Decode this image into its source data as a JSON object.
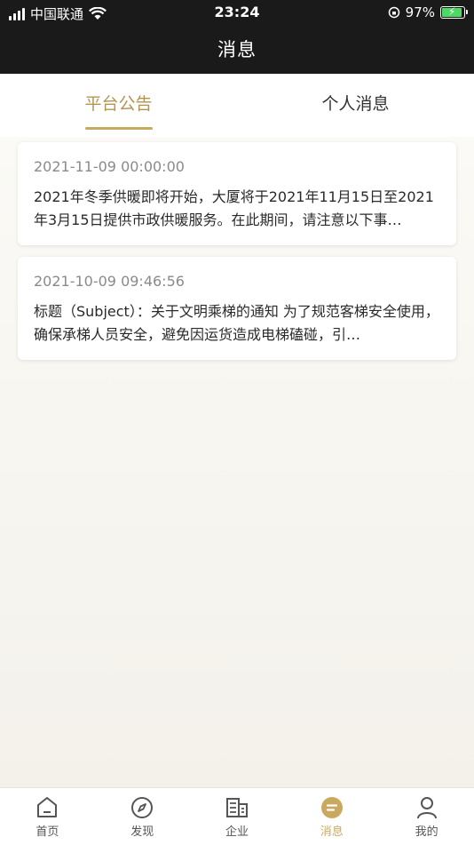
{
  "status_bar": {
    "carrier": "中国联通",
    "time": "23:24",
    "battery": "97%",
    "battery_level": 0.97
  },
  "header": {
    "title": "消息"
  },
  "tabs": [
    {
      "label": "平台公告",
      "active": true
    },
    {
      "label": "个人消息",
      "active": false
    }
  ],
  "messages": [
    {
      "date": "2021-11-09 00:00:00",
      "text": "2021年冬季供暖即将开始，大厦将于2021年11月15日至2021年3月15日提供市政供暖服务。在此期间，请注意以下事…"
    },
    {
      "date": "2021-10-09 09:46:56",
      "text": "标题（Subject）：关于文明乘梯的通知 为了规范客梯安全使用，确保承梯人员安全，避免因运货造成电梯磕碰，引…"
    }
  ],
  "tabbar": [
    {
      "label": "首页",
      "icon": "home-icon"
    },
    {
      "label": "发现",
      "icon": "compass-icon"
    },
    {
      "label": "企业",
      "icon": "building-icon"
    },
    {
      "label": "消息",
      "icon": "message-icon",
      "active": true
    },
    {
      "label": "我的",
      "icon": "user-icon"
    }
  ],
  "colors": {
    "accent": "#c9a95d",
    "topbar": "#1a1a1a"
  }
}
